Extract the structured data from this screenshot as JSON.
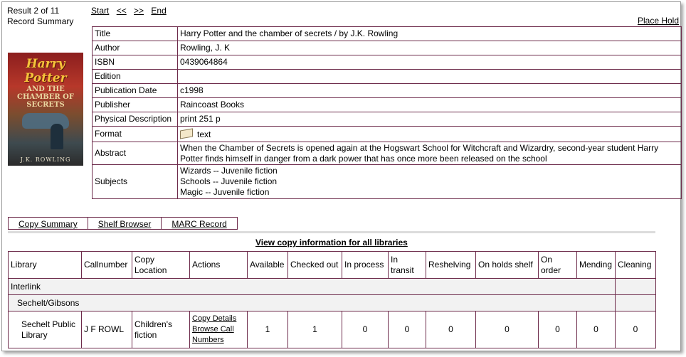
{
  "header": {
    "result": "Result 2 of 11",
    "summary": "Record Summary",
    "nav": {
      "start": "Start",
      "prev": "<<",
      "next": ">>",
      "end": "End"
    },
    "place_hold": "Place Hold"
  },
  "cover": {
    "title": "Harry Potter",
    "subtitle_top": "AND THE",
    "subtitle_bottom": "CHAMBER OF SECRETS",
    "author": "J.K. ROWLING"
  },
  "details": [
    {
      "label": "Title",
      "value": "Harry Potter and the chamber of secrets / by J.K. Rowling"
    },
    {
      "label": "Author",
      "value": "Rowling, J. K"
    },
    {
      "label": "ISBN",
      "value": "0439064864"
    },
    {
      "label": "Edition",
      "value": ""
    },
    {
      "label": "Publication Date",
      "value": "c1998"
    },
    {
      "label": "Publisher",
      "value": "Raincoast Books"
    },
    {
      "label": "Physical Description",
      "value": "print 251 p"
    },
    {
      "label": "Format",
      "value": "text",
      "icon": "book-icon"
    },
    {
      "label": "Abstract",
      "value": "When the Chamber of Secrets is opened again at the Hogswart School for Witchcraft and Wizardry, second-year student Harry Potter finds himself in danger from a dark power that has once more been released on the school"
    },
    {
      "label": "Subjects",
      "lines": [
        "Wizards -- Juvenile fiction",
        "Schools -- Juvenile fiction",
        "Magic -- Juvenile fiction"
      ]
    }
  ],
  "tabs": [
    "Copy Summary",
    "Shelf Browser",
    "MARC Record"
  ],
  "view_all": "View copy information for all libraries",
  "copies": {
    "headers": [
      "Library",
      "Callnumber",
      "Copy Location",
      "Actions",
      "Available",
      "Checked out",
      "In process",
      "In transit",
      "Reshelving",
      "On holds shelf",
      "On order",
      "Mending",
      "Cleaning"
    ],
    "group1": "Interlink",
    "group2": "Sechelt/Gibsons",
    "row": {
      "library": "Sechelt Public Library",
      "callnumber": "J F ROWL",
      "location": "Children's fiction",
      "action1": "Copy Details",
      "action2": "Browse Call Numbers",
      "counts": [
        "1",
        "1",
        "0",
        "0",
        "0",
        "0",
        "0",
        "0",
        "0"
      ]
    }
  }
}
